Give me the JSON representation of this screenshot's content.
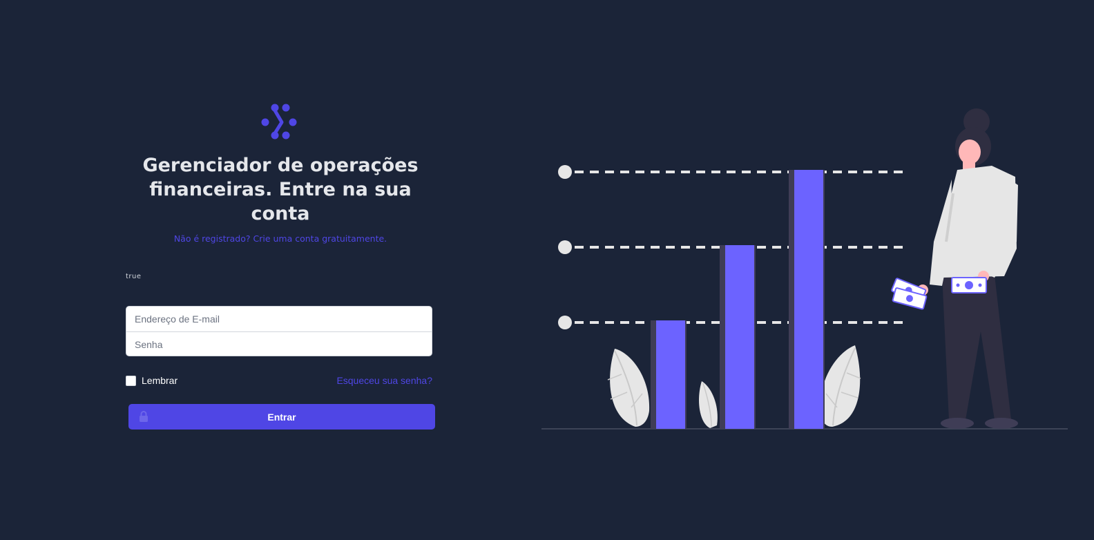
{
  "brand": {
    "logo_icon": "chevron-dots-logo",
    "accent_color": "#4f46e5"
  },
  "login": {
    "headline": "Gerenciador de operações financeiras. Entre na sua conta",
    "register_prompt": "Não é registrado?",
    "register_link": "Crie uma conta gratuitamente.",
    "stray_text": "true",
    "email_placeholder": "Endereço de E-mail",
    "password_placeholder": "Senha",
    "remember_label": "Lembrar",
    "forgot_link": "Esqueceu sua senha?",
    "submit_label": "Entrar",
    "submit_icon": "lock-icon"
  },
  "illustration": {
    "subject": "woman-holding-money-beside-bar-chart",
    "bar_color": "#6c63ff"
  }
}
